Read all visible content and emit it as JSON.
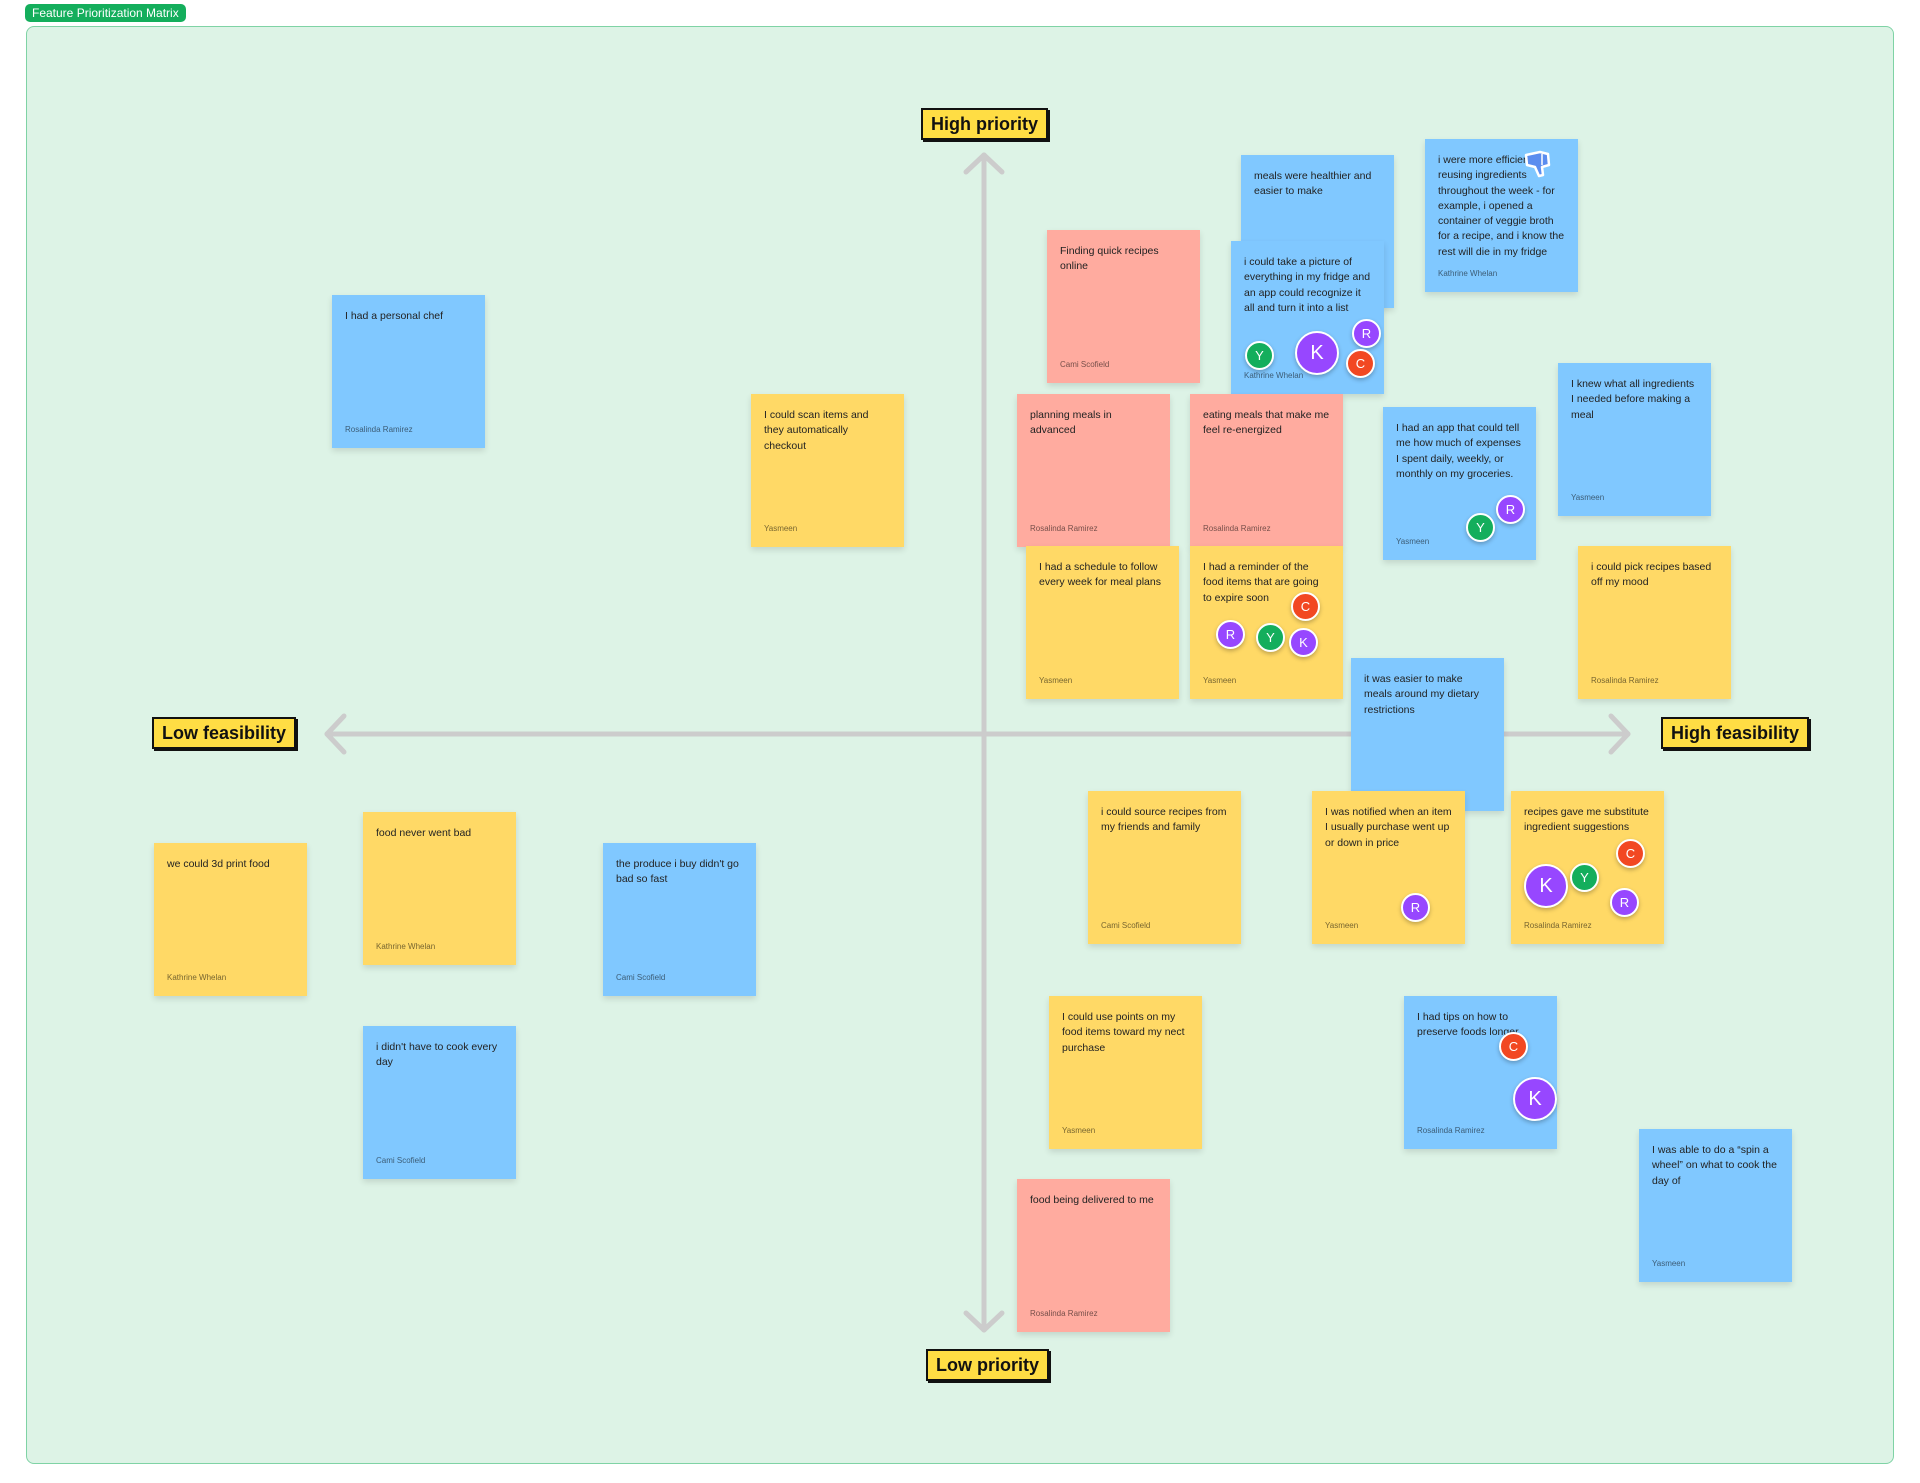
{
  "frame": {
    "title": "Feature Prioritization Matrix"
  },
  "colors": {
    "board": "#ddf3e6",
    "frame_tag": "#14ae5c",
    "yellow": "#ffd966",
    "blue": "#80c8ff",
    "red": "#ffab9f",
    "label": "#ffdd44",
    "axis": "#cccccc"
  },
  "axes": {
    "top": "High priority",
    "bottom": "Low priority",
    "left": "Low feasibility",
    "right": "High feasibility"
  },
  "stickies": [
    {
      "text": "I had a personal chef",
      "author": "Rosalinda Ramirez",
      "color": "blue"
    },
    {
      "text": "I could scan items and they automatically checkout",
      "author": "Yasmeen",
      "color": "yellow"
    },
    {
      "text": "Finding quick recipes online",
      "author": "Cami Scofield",
      "color": "red"
    },
    {
      "text": "meals were healthier and easier to make",
      "author": "",
      "color": "blue"
    },
    {
      "text": "i could take a picture of everything in my fridge and an app could recognize it all and turn it into a list",
      "author": "Kathrine Whelan",
      "color": "blue",
      "votes": [
        "Y",
        "K",
        "R",
        "C"
      ]
    },
    {
      "text": "i were more efficient reusing ingredients throughout the week - for example, i opened a container of veggie broth for a recipe, and i know the rest will die in my fridge",
      "author": "Kathrine Whelan",
      "color": "blue",
      "reaction": "thumbs-down"
    },
    {
      "text": "planning meals in advanced",
      "author": "Rosalinda Ramirez",
      "color": "red"
    },
    {
      "text": "eating meals that make me feel re-energized",
      "author": "Rosalinda Ramirez",
      "color": "red"
    },
    {
      "text": "I had an app that could tell me how much of expenses I spent daily, weekly, or monthly on my groceries.",
      "author": "Yasmeen",
      "color": "blue",
      "votes": [
        "R",
        "Y"
      ]
    },
    {
      "text": " I knew what all ingredients I needed before making a meal",
      "author": "Yasmeen",
      "color": "blue"
    },
    {
      "text": "I had a schedule to follow every week for meal plans",
      "author": "Yasmeen",
      "color": "yellow"
    },
    {
      "text": "I had a reminder of the food items that are going to expire soon",
      "author": "Yasmeen",
      "color": "yellow",
      "votes": [
        "C",
        "R",
        "Y",
        "K"
      ]
    },
    {
      "text": "i could pick recipes based off my mood",
      "author": "Rosalinda Ramirez",
      "color": "yellow"
    },
    {
      "text": "it was easier to make meals around my dietary restrictions",
      "author": "",
      "color": "blue"
    },
    {
      "text": "i could source recipes from my friends and family",
      "author": "Cami Scofield",
      "color": "yellow"
    },
    {
      "text": "I was notified when an item I usually purchase went up or down in price",
      "author": "Yasmeen",
      "color": "yellow",
      "votes": [
        "R"
      ]
    },
    {
      "text": "recipes gave me substitute ingredient suggestions",
      "author": "Rosalinda Ramirez",
      "color": "yellow",
      "votes": [
        "C",
        "K",
        "Y",
        "R"
      ]
    },
    {
      "text": "we could 3d print food",
      "author": "Kathrine Whelan",
      "color": "yellow"
    },
    {
      "text": "food never went bad",
      "author": "Kathrine Whelan",
      "color": "yellow"
    },
    {
      "text": "the produce i buy didn't go bad so fast",
      "author": "Cami Scofield",
      "color": "blue"
    },
    {
      "text": "i didn't have to cook every day",
      "author": "Cami Scofield",
      "color": "blue"
    },
    {
      "text": "I could use points on my food items toward my nect purchase",
      "author": "Yasmeen",
      "color": "yellow"
    },
    {
      "text": "I had tips on how to preserve foods longer",
      "author": "Rosalinda Ramirez",
      "color": "blue",
      "votes": [
        "C",
        "K"
      ]
    },
    {
      "text": "food being delivered to me",
      "author": "Rosalinda Ramirez",
      "color": "red"
    },
    {
      "text": "I was able to do a “spin a wheel” on what to cook the day of",
      "author": "Yasmeen",
      "color": "blue"
    }
  ]
}
